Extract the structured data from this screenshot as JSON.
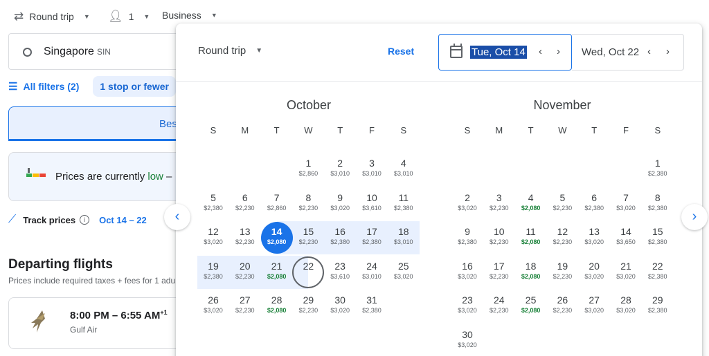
{
  "topbar": {
    "trip_type": "Round trip",
    "passengers": "1",
    "cabin": "Business"
  },
  "search": {
    "origin_city": "Singapore",
    "origin_code": "SIN"
  },
  "filters": {
    "all_filters": "All filters (2)",
    "stops_chip": "1 stop or fewer"
  },
  "sort": {
    "tab_label": "Bes"
  },
  "insight": {
    "text_before": "Prices are currently ",
    "low": "low",
    "text_after": " –"
  },
  "tracking": {
    "label": "Track prices",
    "dates": "Oct 14 – 22"
  },
  "departing": {
    "title": "Departing flights",
    "subtitle": "Prices include required taxes + fees for 1 adu"
  },
  "flight": {
    "time": "8:00 PM – 6:55 AM",
    "day_offset": "+1",
    "airline": "Gulf Air"
  },
  "picker": {
    "trip_type": "Round trip",
    "reset": "Reset",
    "depart_date": "Tue, Oct 14",
    "return_date": "Wed, Oct 22",
    "weekdays": [
      "S",
      "M",
      "T",
      "W",
      "T",
      "F",
      "S"
    ],
    "months": [
      {
        "name": "October",
        "first_weekday": 3,
        "days": [
          {
            "d": "1",
            "p": "$2,860"
          },
          {
            "d": "2",
            "p": "$3,010"
          },
          {
            "d": "3",
            "p": "$3,010"
          },
          {
            "d": "4",
            "p": "$3,010"
          },
          {
            "d": "5",
            "p": "$2,380"
          },
          {
            "d": "6",
            "p": "$2,230"
          },
          {
            "d": "7",
            "p": "$2,860"
          },
          {
            "d": "8",
            "p": "$2,230"
          },
          {
            "d": "9",
            "p": "$3,020"
          },
          {
            "d": "10",
            "p": "$3,610"
          },
          {
            "d": "11",
            "p": "$2,380"
          },
          {
            "d": "12",
            "p": "$3,020"
          },
          {
            "d": "13",
            "p": "$2,230"
          },
          {
            "d": "14",
            "p": "$2,080",
            "sel": "start"
          },
          {
            "d": "15",
            "p": "$2,230"
          },
          {
            "d": "16",
            "p": "$2,380"
          },
          {
            "d": "17",
            "p": "$2,380"
          },
          {
            "d": "18",
            "p": "$3,010"
          },
          {
            "d": "19",
            "p": "$2,380"
          },
          {
            "d": "20",
            "p": "$2,230"
          },
          {
            "d": "21",
            "p": "$2,080",
            "cheap": true
          },
          {
            "d": "22",
            "p": "",
            "sel": "end"
          },
          {
            "d": "23",
            "p": "$3,610"
          },
          {
            "d": "24",
            "p": "$3,010"
          },
          {
            "d": "25",
            "p": "$3,020"
          },
          {
            "d": "26",
            "p": "$3,020"
          },
          {
            "d": "27",
            "p": "$2,230"
          },
          {
            "d": "28",
            "p": "$2,080",
            "cheap": true
          },
          {
            "d": "29",
            "p": "$2,230"
          },
          {
            "d": "30",
            "p": "$3,020"
          },
          {
            "d": "31",
            "p": "$2,380"
          }
        ]
      },
      {
        "name": "November",
        "first_weekday": 6,
        "days": [
          {
            "d": "1",
            "p": "$2,380"
          },
          {
            "d": "2",
            "p": "$3,020"
          },
          {
            "d": "3",
            "p": "$2,230"
          },
          {
            "d": "4",
            "p": "$2,080",
            "cheap": true
          },
          {
            "d": "5",
            "p": "$2,230"
          },
          {
            "d": "6",
            "p": "$2,380"
          },
          {
            "d": "7",
            "p": "$3,020"
          },
          {
            "d": "8",
            "p": "$2,380"
          },
          {
            "d": "9",
            "p": "$2,380"
          },
          {
            "d": "10",
            "p": "$2,230"
          },
          {
            "d": "11",
            "p": "$2,080",
            "cheap": true
          },
          {
            "d": "12",
            "p": "$2,230"
          },
          {
            "d": "13",
            "p": "$3,020"
          },
          {
            "d": "14",
            "p": "$3,650"
          },
          {
            "d": "15",
            "p": "$2,380"
          },
          {
            "d": "16",
            "p": "$3,020"
          },
          {
            "d": "17",
            "p": "$2,230"
          },
          {
            "d": "18",
            "p": "$2,080",
            "cheap": true
          },
          {
            "d": "19",
            "p": "$2,230"
          },
          {
            "d": "20",
            "p": "$3,020"
          },
          {
            "d": "21",
            "p": "$3,020"
          },
          {
            "d": "22",
            "p": "$2,380"
          },
          {
            "d": "23",
            "p": "$3,020"
          },
          {
            "d": "24",
            "p": "$2,230"
          },
          {
            "d": "25",
            "p": "$2,080",
            "cheap": true
          },
          {
            "d": "26",
            "p": "$2,230"
          },
          {
            "d": "27",
            "p": "$3,020"
          },
          {
            "d": "28",
            "p": "$3,020"
          },
          {
            "d": "29",
            "p": "$2,380"
          },
          {
            "d": "30",
            "p": "$3,020"
          }
        ]
      }
    ]
  },
  "colors": {
    "accent": "#1a73e8",
    "range": "#e8f0fe",
    "cheap": "#188038"
  }
}
